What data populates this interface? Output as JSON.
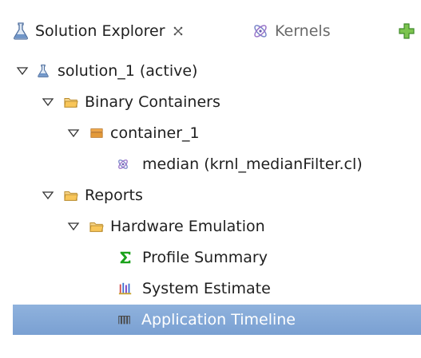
{
  "tabs": [
    {
      "label": "Solution Explorer",
      "active": true,
      "icon": "flask-icon"
    },
    {
      "label": "Kernels",
      "active": false,
      "icon": "kernel-icon"
    }
  ],
  "toolbar": {
    "add_icon": "plus-icon"
  },
  "tree": [
    {
      "label": "solution_1 (active)",
      "icon": "flask-icon",
      "expanded": true,
      "depth": 0
    },
    {
      "label": "Binary Containers",
      "icon": "folder-icon",
      "expanded": true,
      "depth": 1
    },
    {
      "label": "container_1",
      "icon": "container-icon",
      "expanded": true,
      "depth": 2
    },
    {
      "label": "median (krnl_medianFilter.cl)",
      "icon": "kernel-icon",
      "depth": 3
    },
    {
      "label": "Reports",
      "icon": "folder-icon",
      "expanded": true,
      "depth": 1
    },
    {
      "label": "Hardware Emulation",
      "icon": "folder-icon",
      "expanded": true,
      "depth": 2
    },
    {
      "label": "Profile Summary",
      "icon": "sigma-icon",
      "depth": 3
    },
    {
      "label": "System Estimate",
      "icon": "bar-chart-icon",
      "depth": 3
    },
    {
      "label": "Application Timeline",
      "icon": "timeline-icon",
      "depth": 3,
      "selected": true
    }
  ],
  "colors": {
    "selection": "#7fa6d6",
    "folder": "#f2c36b",
    "container": "#e9a040",
    "sigma": "#1a9a1a",
    "plus": "#5bb53a"
  }
}
